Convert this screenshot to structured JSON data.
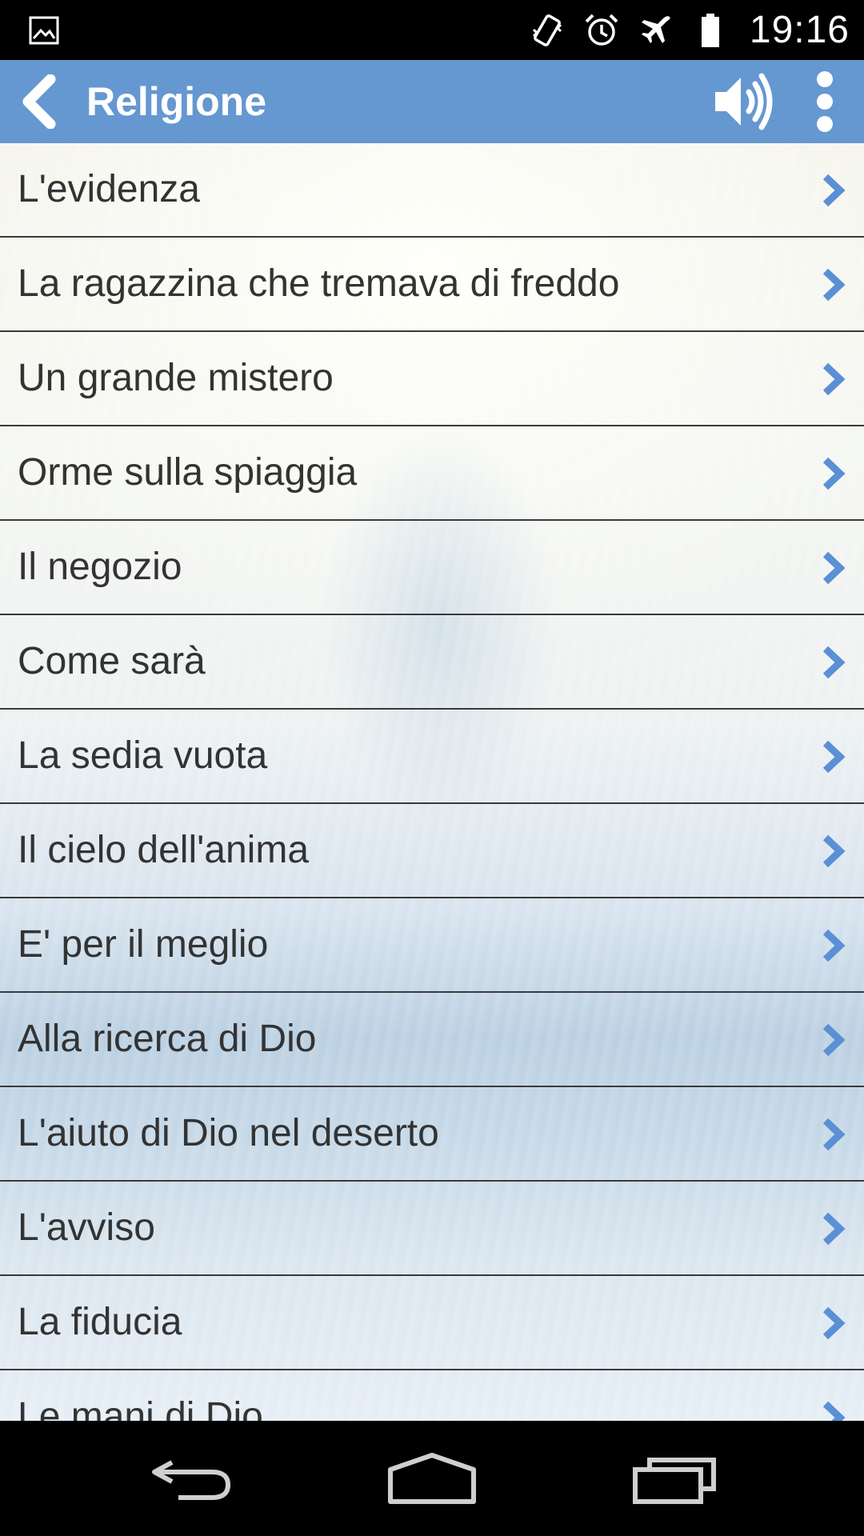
{
  "status_bar": {
    "time": "19:16",
    "icons": [
      "image-icon",
      "vibrate-icon",
      "alarm-icon",
      "airplane-mode-icon",
      "battery-icon"
    ]
  },
  "action_bar": {
    "title": "Religione",
    "background_color": "#6597d1",
    "icons": [
      "back-icon",
      "sound-icon",
      "overflow-menu-icon"
    ]
  },
  "list": {
    "items": [
      "L'evidenza",
      "La ragazzina che tremava di freddo",
      "Un grande mistero",
      "Orme sulla spiaggia",
      "Il negozio",
      "Come sarà",
      "La sedia vuota",
      "Il cielo dell'anima",
      "E' per il meglio",
      "Alla ricerca di Dio",
      "L'aiuto di Dio nel deserto",
      "L'avviso",
      "La fiducia",
      "Le mani di Dio"
    ],
    "chevron_color": "#5b8fd6"
  },
  "nav_bar": {
    "icons": [
      "back-nav-icon",
      "home-icon",
      "recents-icon"
    ]
  }
}
